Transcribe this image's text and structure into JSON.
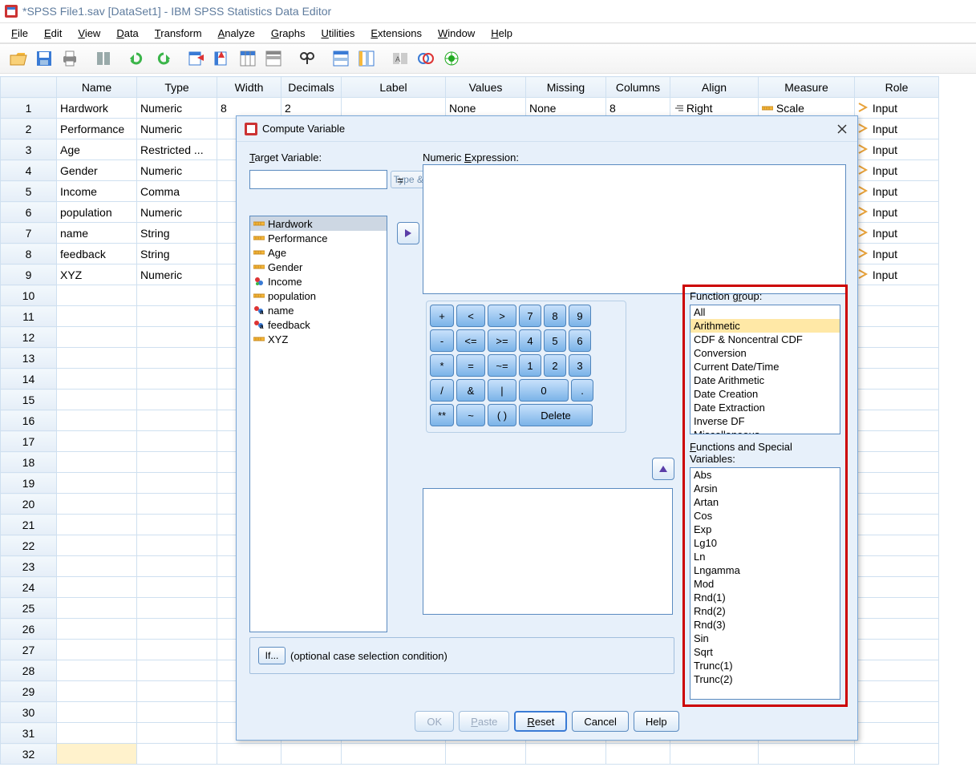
{
  "title": "*SPSS File1.sav [DataSet1] - IBM SPSS Statistics Data Editor",
  "menu": [
    "File",
    "Edit",
    "View",
    "Data",
    "Transform",
    "Analyze",
    "Graphs",
    "Utilities",
    "Extensions",
    "Window",
    "Help"
  ],
  "columns": [
    "",
    "Name",
    "Type",
    "Width",
    "Decimals",
    "Label",
    "Values",
    "Missing",
    "Columns",
    "Align",
    "Measure",
    "Role"
  ],
  "rows": [
    {
      "n": 1,
      "name": "Hardwork",
      "type": "Numeric",
      "width": "8",
      "decimals": "2",
      "label": "",
      "values": "None",
      "missing": "None",
      "columns": "8",
      "align": "Right",
      "measure": "Scale",
      "role": "Input"
    },
    {
      "n": 2,
      "name": "Performance",
      "type": "Numeric",
      "role": "Input"
    },
    {
      "n": 3,
      "name": "Age",
      "type": "Restricted ...",
      "role": "Input"
    },
    {
      "n": 4,
      "name": "Gender",
      "type": "Numeric",
      "role": "Input"
    },
    {
      "n": 5,
      "name": "Income",
      "type": "Comma",
      "role": "Input"
    },
    {
      "n": 6,
      "name": "population",
      "type": "Numeric",
      "role": "Input"
    },
    {
      "n": 7,
      "name": "name",
      "type": "String",
      "role": "Input"
    },
    {
      "n": 8,
      "name": "feedback",
      "type": "String",
      "role": "Input"
    },
    {
      "n": 9,
      "name": "XYZ",
      "type": "Numeric",
      "role": "Input"
    }
  ],
  "empty_rows": [
    10,
    11,
    12,
    13,
    14,
    15,
    16,
    17,
    18,
    19,
    20,
    21,
    22,
    23,
    24,
    25,
    26,
    27,
    28,
    29,
    30,
    31,
    32
  ],
  "dialog": {
    "title": "Compute Variable",
    "target_label": "Target Variable:",
    "type_label_btn": "Type & Label...",
    "numeric_expr_label": "Numeric Expression:",
    "vars": [
      {
        "name": "Hardwork",
        "icon": "ruler",
        "selected": true
      },
      {
        "name": "Performance",
        "icon": "ruler"
      },
      {
        "name": "Age",
        "icon": "ruler"
      },
      {
        "name": "Gender",
        "icon": "ruler"
      },
      {
        "name": "Income",
        "icon": "nominal"
      },
      {
        "name": "population",
        "icon": "ruler"
      },
      {
        "name": "name",
        "icon": "string"
      },
      {
        "name": "feedback",
        "icon": "string"
      },
      {
        "name": "XYZ",
        "icon": "ruler"
      }
    ],
    "keypad": [
      [
        "+",
        "<",
        ">",
        "7",
        "8",
        "9"
      ],
      [
        "-",
        "<=",
        ">=",
        "4",
        "5",
        "6"
      ],
      [
        "*",
        "=",
        "~=",
        "1",
        "2",
        "3"
      ],
      [
        "/",
        "&",
        "|",
        "0",
        "."
      ],
      [
        "**",
        "~",
        "( )",
        "Delete"
      ]
    ],
    "func_group_label": "Function group:",
    "func_group": [
      "All",
      "Arithmetic",
      "CDF & Noncentral CDF",
      "Conversion",
      "Current Date/Time",
      "Date Arithmetic",
      "Date Creation",
      "Date Extraction",
      "Inverse DF",
      "Miscellaneous"
    ],
    "func_group_selected": 1,
    "funcs_label": "Functions and Special Variables:",
    "funcs": [
      "Abs",
      "Arsin",
      "Artan",
      "Cos",
      "Exp",
      "Lg10",
      "Ln",
      "Lngamma",
      "Mod",
      "Rnd(1)",
      "Rnd(2)",
      "Rnd(3)",
      "Sin",
      "Sqrt",
      "Trunc(1)",
      "Trunc(2)"
    ],
    "if_btn": "If...",
    "if_text": "(optional case selection condition)",
    "buttons": {
      "ok": "OK",
      "paste": "Paste",
      "reset": "Reset",
      "cancel": "Cancel",
      "help": "Help"
    }
  }
}
